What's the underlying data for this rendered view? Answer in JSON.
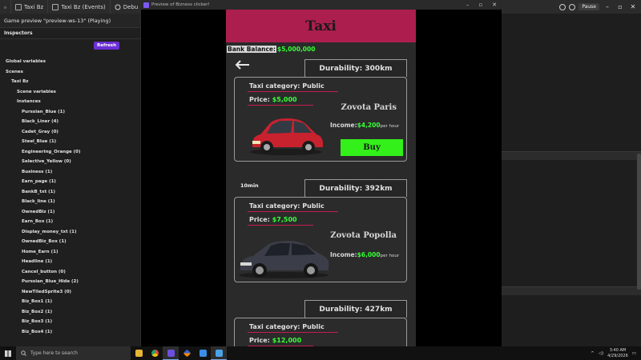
{
  "editor": {
    "tabs": [
      {
        "label": ""
      },
      {
        "label": "Taxi Bz"
      },
      {
        "label": "Taxi Bz (Events)"
      },
      {
        "label": "Debu"
      }
    ],
    "pause_label": "Pause"
  },
  "left_panel": {
    "title": "Game preview \"preview-ws-13\" (Playing)",
    "inspectors": "Inspectors",
    "refresh": "Refresh",
    "tree": [
      {
        "label": "Global variables",
        "level": 0
      },
      {
        "label": "Scenes",
        "level": 0
      },
      {
        "label": "Taxi Bz",
        "level": 1
      },
      {
        "label": "Scene variables",
        "level": 2
      },
      {
        "label": "Instances",
        "level": 2
      },
      {
        "label": "Purssian_Blue (1)",
        "level": 3
      },
      {
        "label": "Black_Liner (4)",
        "level": 3
      },
      {
        "label": "Cadet_Gray (0)",
        "level": 3
      },
      {
        "label": "Steel_Blue (1)",
        "level": 3
      },
      {
        "label": "Engineering_Orange (0)",
        "level": 3
      },
      {
        "label": "Selective_Yellow (0)",
        "level": 3
      },
      {
        "label": "Business (1)",
        "level": 3
      },
      {
        "label": "Earn_page (1)",
        "level": 3
      },
      {
        "label": "BankB_txt (1)",
        "level": 3
      },
      {
        "label": "Black_line (1)",
        "level": 3
      },
      {
        "label": "OwnedBiz (1)",
        "level": 3
      },
      {
        "label": "Earn_Box (1)",
        "level": 3
      },
      {
        "label": "Display_money_txt (1)",
        "level": 3
      },
      {
        "label": "OwnedBiz_Box (1)",
        "level": 3
      },
      {
        "label": "Home_Earn (1)",
        "level": 3
      },
      {
        "label": "Headline (1)",
        "level": 3
      },
      {
        "label": "Cancel_button (0)",
        "level": 3
      },
      {
        "label": "Purssian_Blue_Hide (2)",
        "level": 3
      },
      {
        "label": "NewTiledSprite3 (0)",
        "level": 3
      },
      {
        "label": "Biz_Box1 (1)",
        "level": 3
      },
      {
        "label": "Biz_Box2 (1)",
        "level": 3
      },
      {
        "label": "Biz_Box3 (1)",
        "level": 3
      },
      {
        "label": "Biz_Box4 (1)",
        "level": 3
      }
    ]
  },
  "game_window": {
    "title": "Preview of Bizness clicker!"
  },
  "game": {
    "header": "Taxi",
    "bank_label": "Bank Balance:",
    "bank_value": "$5,000,000",
    "back_icon": "arrow-left-icon",
    "timer": "10min",
    "cards": [
      {
        "durability": "Durability: 300km",
        "category": "Taxi category: Public",
        "price_label": "Price:",
        "price": "$5,000",
        "name": "Zovota Paris",
        "income_label": "Income:",
        "income": "$4,200",
        "income_unit": "per hour",
        "buy": "Buy",
        "car_color": "#c8222e"
      },
      {
        "durability": "Durability: 392km",
        "category": "Taxi category: Public",
        "price_label": "Price:",
        "price": "$7,500",
        "name": "Zovota Popolla",
        "income_label": "Income:",
        "income": "$6,000",
        "income_unit": "per hour",
        "car_color": "#3b3e48"
      },
      {
        "durability": "Durability: 427km",
        "category": "Taxi category: Public",
        "price_label": "Price:",
        "price": "$12,000"
      }
    ],
    "colors": {
      "header": "#ac1e4e",
      "accent_green": "#37ff37",
      "buy_button": "#33f01a",
      "underline": "#c21d4f"
    }
  },
  "taskbar": {
    "search_placeholder": "Type here to search",
    "time": "3:40 AM",
    "date": "4/29/2026"
  }
}
